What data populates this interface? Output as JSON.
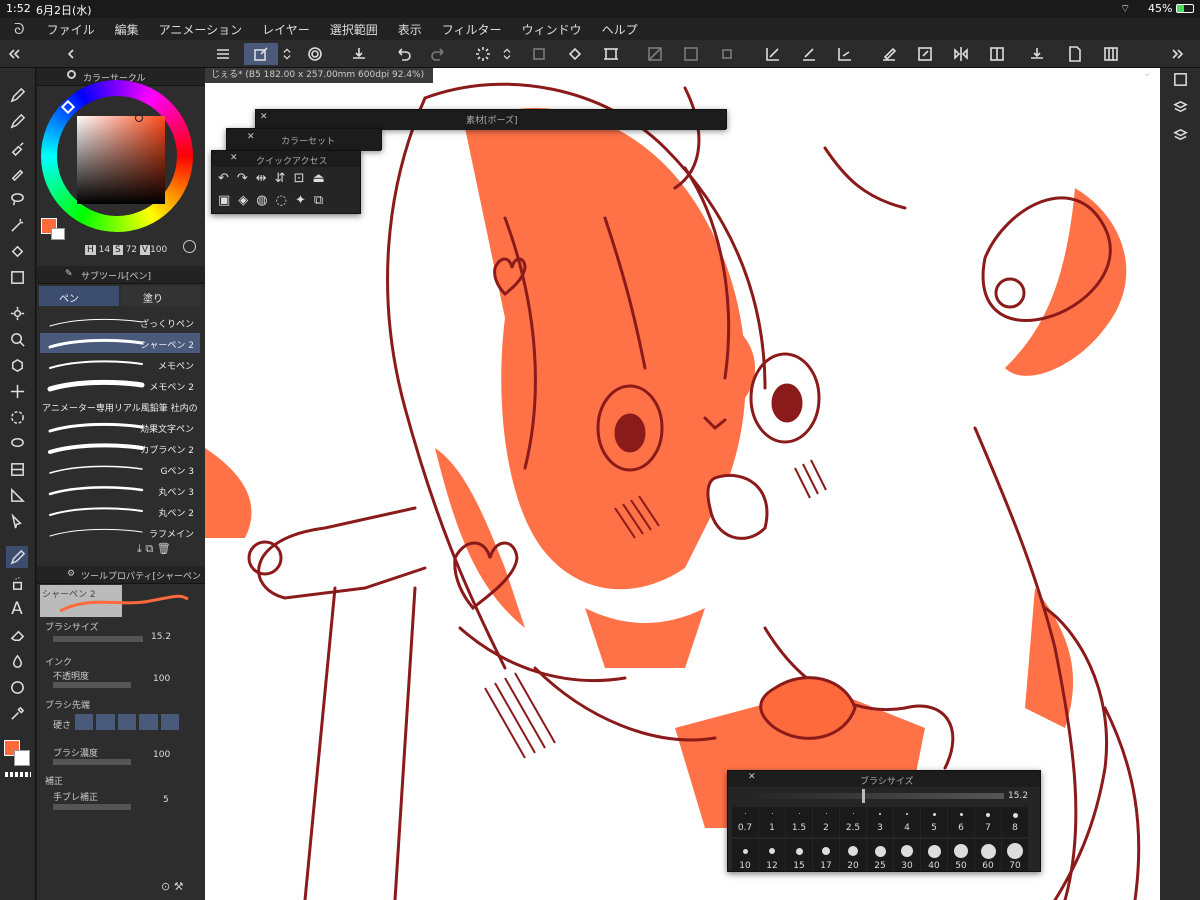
{
  "status": {
    "time": "1:52",
    "date": "6月2日(水)",
    "battery": "45%"
  },
  "menu": [
    "ファイル",
    "編集",
    "アニメーション",
    "レイヤー",
    "選択範囲",
    "表示",
    "フィルター",
    "ウィンドウ",
    "ヘルプ"
  ],
  "document_tab": "じぇる* (B5 182.00 x 257.00mm 600dpi 92.4%)",
  "color_panel": {
    "title": "カラーサークル",
    "h_label": "H",
    "h": "14",
    "s_label": "S",
    "s": "72",
    "v_label": "V",
    "v": "100",
    "main_color": "#ff6a3d"
  },
  "subtool": {
    "title": "サブツール[ペン]",
    "tabs": [
      "ペン",
      "塗り"
    ],
    "brushes": [
      "ざっくりペン",
      "シャーペン 2",
      "メモペン",
      "メモペン 2",
      "アニメーター専用リアル風鉛筆 社内の",
      "効果文字ペン",
      "カブラペン 2",
      "Gペン 3",
      "丸ペン 3",
      "丸ペン 2",
      "ラフメイン"
    ]
  },
  "tool_property": {
    "title": "ツールプロパティ[シャーペン",
    "preview_name": "シャーペン 2",
    "brush_size_label": "ブラシサイズ",
    "brush_size": "15.2",
    "ink_label": "インク",
    "opacity_label": "不透明度",
    "opacity": "100",
    "tip_label": "ブラシ先端",
    "hardness_label": "硬さ",
    "density_label": "ブラシ濃度",
    "density": "100",
    "correction_label": "補正",
    "stabilize_label": "手ブレ補正",
    "stabilize": "5"
  },
  "floating": {
    "material": "素材[ポーズ]",
    "colorset": "カラーセット",
    "quick": "クイックアクセス",
    "brushsize_title": "ブラシサイズ",
    "brushsize_value": "15.2",
    "sizes_top": [
      "0.7",
      "1",
      "1.5",
      "2",
      "2.5",
      "3",
      "4",
      "5",
      "6",
      "7",
      "8"
    ],
    "sizes_bottom": [
      "10",
      "12",
      "15",
      "17",
      "20",
      "25",
      "30",
      "40",
      "50",
      "60",
      "70"
    ]
  },
  "accent": "#ff6a3d",
  "line_color": "#8b1a1a"
}
